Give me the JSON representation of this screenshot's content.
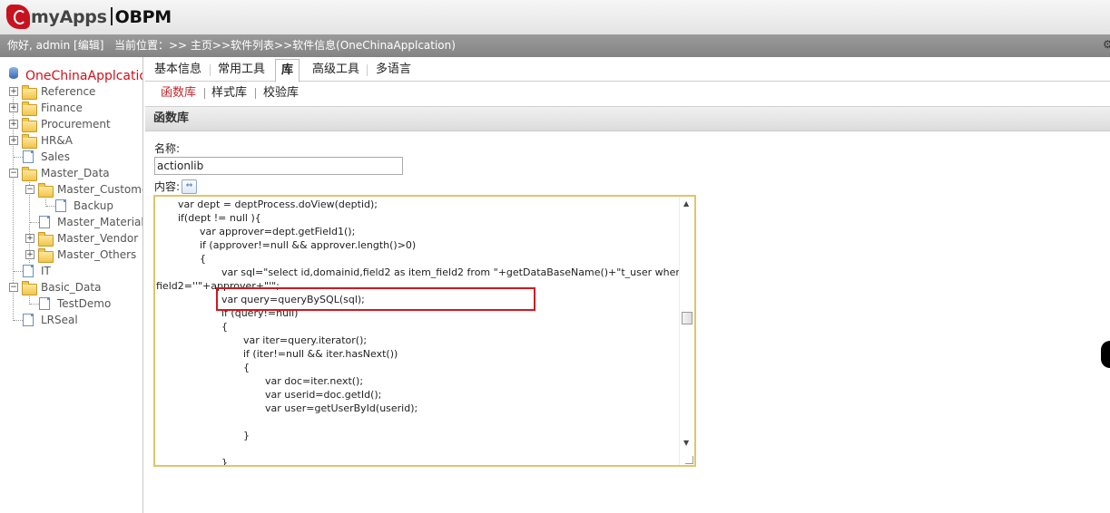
{
  "header": {
    "logo_brand": "myApps",
    "logo_product": "OBPM"
  },
  "greeting": {
    "text": "你好, admin [编辑]",
    "breadcrumb": "当前位置：>> 主页>>软件列表>>软件信息(OneChinaApplcation)"
  },
  "sidebar": {
    "root_label": "OneChinaApplcation",
    "items": [
      {
        "label": "Reference"
      },
      {
        "label": "Finance"
      },
      {
        "label": "Procurement"
      },
      {
        "label": "HR&A"
      },
      {
        "label": "Sales"
      },
      {
        "label": "Master_Data"
      },
      {
        "label": "Master_Customer"
      },
      {
        "label": "Backup"
      },
      {
        "label": "Master_Material"
      },
      {
        "label": "Master_Vendor"
      },
      {
        "label": "Master_Others"
      },
      {
        "label": "IT"
      },
      {
        "label": "Basic_Data"
      },
      {
        "label": "TestDemo"
      },
      {
        "label": "LRSeal"
      }
    ]
  },
  "tabs": [
    {
      "label": "基本信息"
    },
    {
      "label": "常用工具"
    },
    {
      "label": "库"
    },
    {
      "label": "高级工具"
    },
    {
      "label": "多语言"
    }
  ],
  "subtabs": [
    {
      "label": "函数库"
    },
    {
      "label": "样式库"
    },
    {
      "label": "校验库"
    }
  ],
  "panel": {
    "title": "函数库"
  },
  "form": {
    "name_label": "名称:",
    "name_value": "actionlib",
    "content_label": "内容:"
  },
  "editor": {
    "lines": [
      "var dept  = deptProcess.doView(deptid);",
      "if(dept != null ){",
      "var approver=dept.getField1();",
      "if (approver!=null && approver.length()>0)",
      "{",
      "",
      "var sql=\"select id,domainid,field2 as item_field2 from \"+getDataBaseName()+\"t_user where",
      "field2=''\"+approver+\"'\";",
      "var query=queryBySQL(sql);",
      "if (query!=null)",
      "{",
      "var iter=query.iterator();",
      "if (iter!=null && iter.hasNext())",
      "{",
      "var doc=iter.next();",
      "var userid=doc.getId();",
      "var user=getUserById(userid);",
      "",
      "}",
      "",
      "}"
    ]
  }
}
